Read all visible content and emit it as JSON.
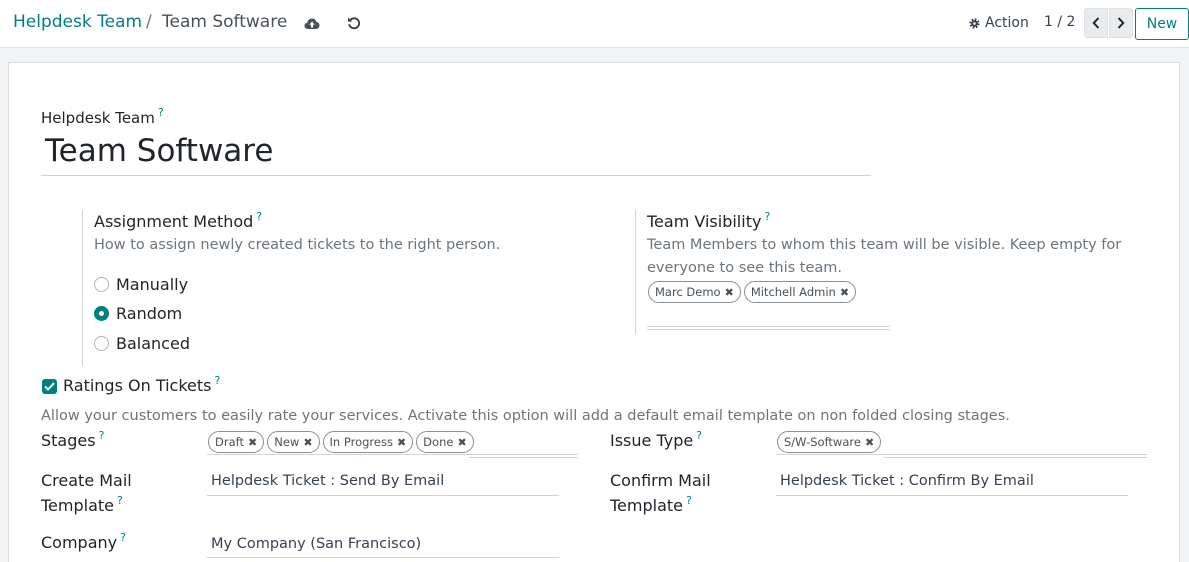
{
  "breadcrumb": {
    "parent": "Helpdesk Team",
    "separator": "/",
    "current": "Team Software"
  },
  "control": {
    "action_label": "Action",
    "pager_value": "1 / 2",
    "new_label": "New"
  },
  "form": {
    "name_label": "Helpdesk Team",
    "help_mark": "?",
    "name_value": "Team Software",
    "assignment": {
      "label": "Assignment Method",
      "description": "How to assign newly created tickets to the right person.",
      "options": [
        "Manually",
        "Random",
        "Balanced"
      ],
      "selected": "Random"
    },
    "visibility": {
      "label": "Team Visibility",
      "description_line1": "Team Members to whom this team will be visible. Keep empty for",
      "description_line2": "everyone to see this team.",
      "tags": [
        "Marc Demo",
        "Mitchell Admin"
      ]
    },
    "ratings": {
      "label": "Ratings On Tickets",
      "checked": true,
      "description": "Allow your customers to easily rate your services. Activate this option will add a default email template on non folded closing stages."
    },
    "stages": {
      "label": "Stages",
      "tags": [
        "Draft",
        "New",
        "In Progress",
        "Done"
      ]
    },
    "issue_type": {
      "label": "Issue Type",
      "tags": [
        "S/W-Software"
      ]
    },
    "create_mail": {
      "label_line1": "Create Mail",
      "label_line2": "Template",
      "value": "Helpdesk Ticket : Send By Email"
    },
    "confirm_mail": {
      "label_line1": "Confirm Mail",
      "label_line2": "Template",
      "value": "Helpdesk Ticket : Confirm By Email"
    },
    "company": {
      "label": "Company",
      "value": "My Company (San Francisco)"
    }
  },
  "colors": {
    "accent": "#017e84",
    "muted_text": "#6c757d",
    "background": "#f2f3f5"
  },
  "icons": {
    "save": "cloud-upload-icon",
    "discard": "undo-icon",
    "action": "gear-icon",
    "prev": "chevron-left-icon",
    "next": "chevron-right-icon",
    "tag_remove": "close-icon",
    "checkbox": "checkmark-icon"
  }
}
